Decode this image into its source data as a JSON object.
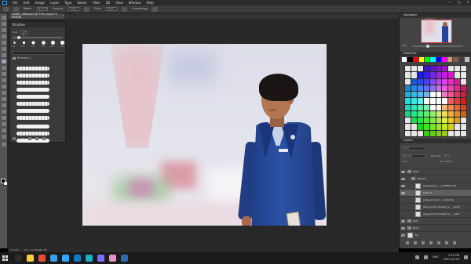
{
  "app": {
    "menu": [
      "File",
      "Edit",
      "Image",
      "Layer",
      "Type",
      "Select",
      "Filter",
      "3D",
      "View",
      "Window",
      "Help"
    ],
    "window_controls": [
      "—",
      "□",
      "✕"
    ]
  },
  "options_bar": {
    "mode_label": "Mode:",
    "mode_value": "Normal",
    "opacity_label": "Opacity:",
    "opacity_value": "100%",
    "flow_label": "Flow:",
    "flow_value": "100%",
    "smoothing_label": "Smoothing:"
  },
  "document_tab": {
    "title": "ZVAEE_MAN.psd @ 33% (Layer 2, RGB/8)",
    "close": "×"
  },
  "brushes_panel": {
    "title": "Brushes",
    "size_label": "Size:",
    "size_value": "175 px",
    "preset_sizes": [
      "30",
      "100",
      "150",
      "175",
      "200",
      "250"
    ],
    "folder_label": "Brushes 1",
    "footer_value": "175"
  },
  "navigator": {
    "title": "Navigator",
    "zoom": "33%"
  },
  "swatches": {
    "title": "Swatches",
    "colors": [
      "#ffffff",
      "#000000",
      "#ff0000",
      "#ffff00",
      "#00ff00",
      "#00ffff",
      "#0000ff",
      "#ff00ff",
      "#d0a070",
      "#806040",
      "#404040",
      "#c0c0c0"
    ]
  },
  "layers_panel": {
    "title": "Layers",
    "kind_label": "Kind",
    "blend_mode": "Normal",
    "opacity_label": "Opacity:",
    "opacity_value": "100%",
    "lock_label": "Lock:",
    "fill_label": "Fill: 100%",
    "layers": [
      {
        "name": "Gabe",
        "type": "group",
        "visible": true,
        "selected": false,
        "indent": 0
      },
      {
        "name": "Shaded",
        "type": "group",
        "visible": true,
        "selected": false,
        "indent": 1
      },
      {
        "name": "jiang_amos_..._a_pfitate_lila",
        "type": "layer",
        "visible": true,
        "selected": false,
        "indent": 2
      },
      {
        "name": "Layer 2",
        "type": "layer",
        "visible": true,
        "selected": true,
        "indent": 2
      },
      {
        "name": "jiang_amos_d..._b_kaviliau",
        "type": "layer",
        "visible": false,
        "selected": false,
        "indent": 2
      },
      {
        "name": "jiang_amos_dressed_s_..._brilgr",
        "type": "layer",
        "visible": false,
        "selected": false,
        "indent": 2
      },
      {
        "name": "jiang_amos_dressed_s_..._oden",
        "type": "layer",
        "visible": false,
        "selected": false,
        "indent": 2
      },
      {
        "name": "Rem",
        "type": "group",
        "visible": true,
        "selected": false,
        "indent": 0
      },
      {
        "name": "Body",
        "type": "group",
        "visible": true,
        "selected": false,
        "indent": 0
      },
      {
        "name": "bg",
        "type": "layer",
        "visible": true,
        "selected": false,
        "indent": 0
      }
    ]
  },
  "status_bar": {
    "zoom": "33.33%",
    "doc_info": "Doc: 24.7M/281.7M"
  },
  "taskbar": {
    "time": "2:51 PM",
    "date": "2020-02-09",
    "language": "ENG",
    "icon_colors": [
      "#2d2d2d",
      "#ffcc33",
      "#e74c3c",
      "#3aa0e8",
      "#31a8ff",
      "#0f7cc0",
      "#1ab3c7",
      "#7c6cff",
      "#e98dcb",
      "#2b6cb0"
    ]
  },
  "colors": {
    "ui_dark": "#2b2b2b",
    "panel": "#434343",
    "ps_blue": "#31a8ff"
  }
}
